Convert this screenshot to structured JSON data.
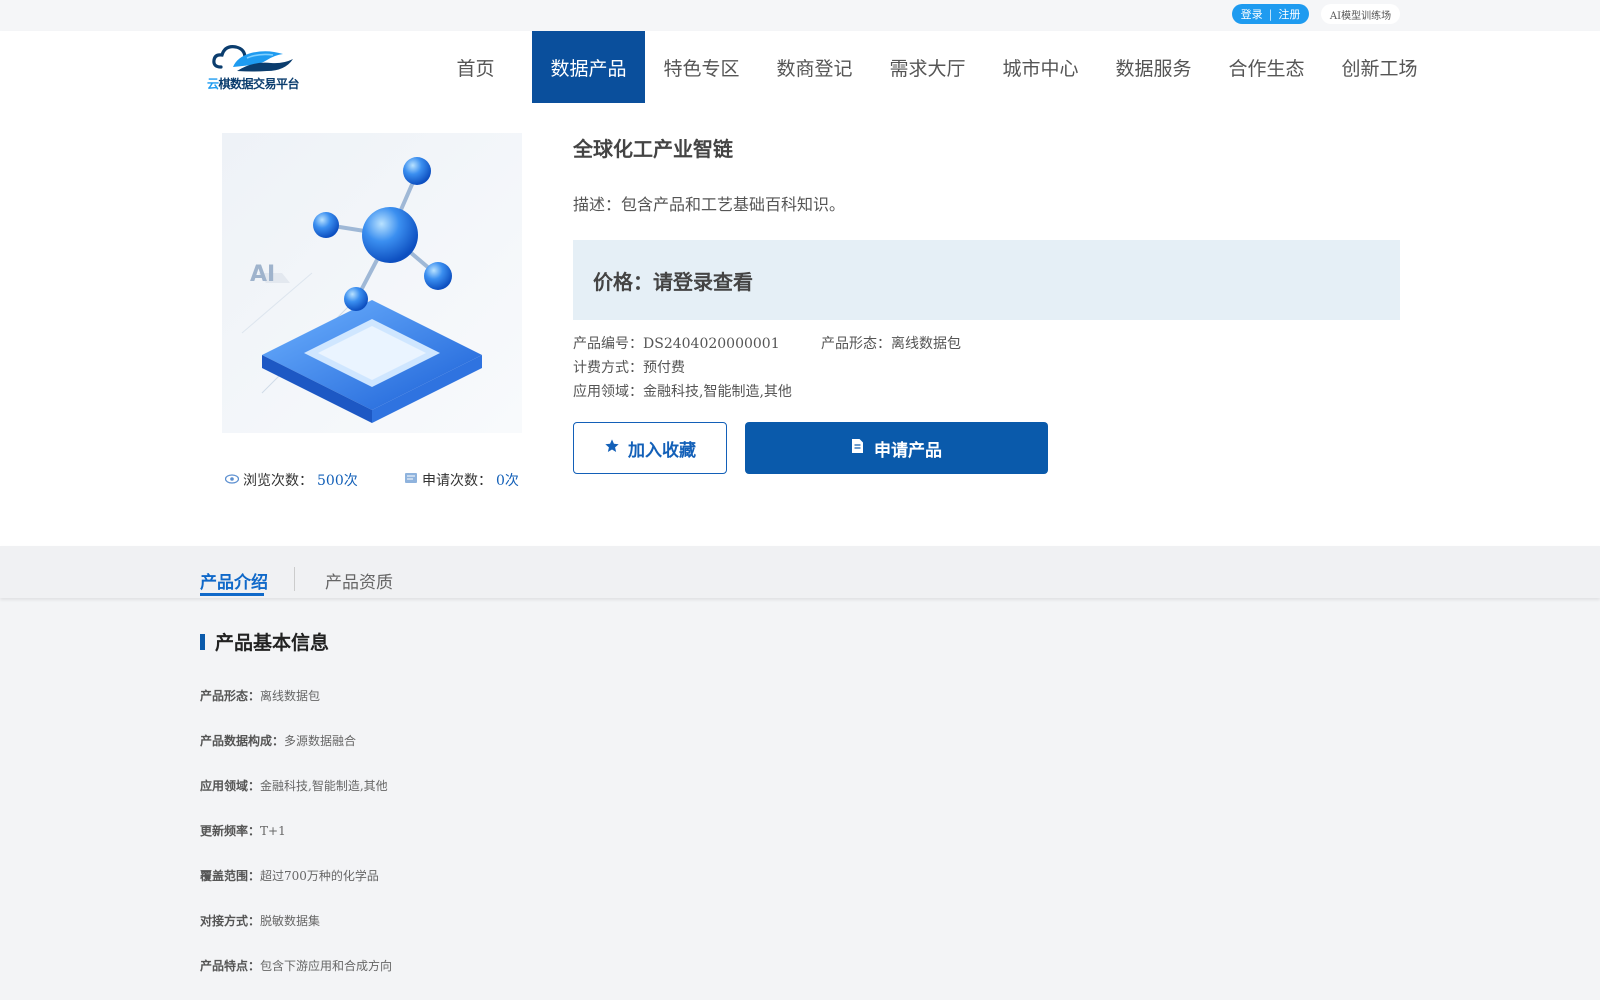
{
  "topbar": {
    "login_label": "登录",
    "separator": "|",
    "register_label": "注册",
    "ai_label": "AI模型训练场"
  },
  "header": {
    "logo_text_part1": "云",
    "logo_text_part2": "棋数据交易平台",
    "nav": [
      {
        "label": "首页",
        "active": false
      },
      {
        "label": "数据产品",
        "active": true
      },
      {
        "label": "特色专区",
        "active": false
      },
      {
        "label": "数商登记",
        "active": false
      },
      {
        "label": "需求大厅",
        "active": false
      },
      {
        "label": "城市中心",
        "active": false
      },
      {
        "label": "数据服务",
        "active": false
      },
      {
        "label": "合作生态",
        "active": false
      },
      {
        "label": "创新工场",
        "active": false
      }
    ]
  },
  "product": {
    "title": "全球化工产业智链",
    "description": "描述：包含产品和工艺基础百科知识。",
    "price": "价格：请登录查看",
    "code_label": "产品编号：",
    "code": "DS2404020000001",
    "form_label": "产品形态：",
    "form": "离线数据包",
    "billing_label": "计费方式：",
    "billing": "预付费",
    "domain_label": "应用领域：",
    "domain": "金融科技,智能制造,其他",
    "views_label": "浏览次数：",
    "views": "500次",
    "applies_label": "申请次数：",
    "applies": "0次",
    "favorite_label": "加入收藏",
    "apply_label": "申请产品"
  },
  "tabs": {
    "intro": "产品介绍",
    "qualification": "产品资质"
  },
  "info": {
    "section_title": "产品基本信息",
    "rows": [
      {
        "label": "产品形态：",
        "value": "离线数据包"
      },
      {
        "label": "产品数据构成：",
        "value": "多源数据融合"
      },
      {
        "label": "应用领域：",
        "value": "金融科技,智能制造,其他"
      },
      {
        "label": "更新频率：",
        "value": "T+1"
      },
      {
        "label": "覆盖范围：",
        "value": "超过700万种的化学品"
      },
      {
        "label": "对接方式：",
        "value": "脱敏数据集"
      },
      {
        "label": "产品特点：",
        "value": "包含下游应用和合成方向"
      }
    ]
  },
  "colors": {
    "primary": "#0a5aab",
    "accent": "#1e9bf0",
    "price_bg": "#e5eff6"
  }
}
